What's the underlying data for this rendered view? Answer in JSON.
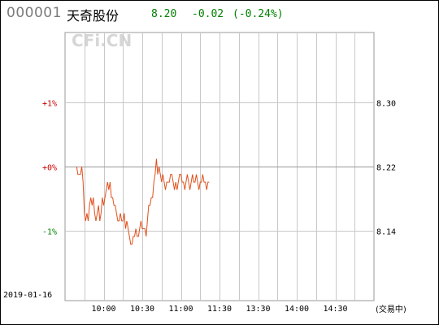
{
  "header": {
    "code": "000001",
    "name": "天奇股份",
    "price": "8.20",
    "change": "-0.02",
    "change_pct": "(-0.24%)"
  },
  "watermark": "CFi.CN",
  "date": "2019-01-16",
  "status": "(交易中)",
  "colors": {
    "up": "#cc0000",
    "flat": "#cc0000",
    "down": "#008000",
    "line": "#e0501c",
    "grid": "#c8c8c8",
    "zero": "#999999"
  },
  "chart_data": {
    "type": "line",
    "title": "",
    "xlabel": "",
    "ylabel": "",
    "prev_close": 8.22,
    "ylim_pct": [
      -2.1,
      2.1
    ],
    "grid": true,
    "x_ticks": [
      "10:00",
      "10:30",
      "11:00",
      "11:30",
      "13:30",
      "14:00",
      "14:30"
    ],
    "y_left_ticks": [
      {
        "label": "+1%",
        "pct": 1,
        "tone": "up"
      },
      {
        "label": "+0%",
        "pct": 0,
        "tone": "flat"
      },
      {
        "label": "-1%",
        "pct": -1,
        "tone": "down"
      }
    ],
    "y_right_ticks": [
      {
        "label": "8.30",
        "pct": 1
      },
      {
        "label": "8.22",
        "pct": 0
      },
      {
        "label": "8.14",
        "pct": -1
      }
    ],
    "session_minutes": [
      0,
      240
    ],
    "series": [
      {
        "x": [
          9,
          10,
          11,
          12,
          13,
          14,
          15,
          16,
          17,
          18,
          19,
          20,
          21,
          22,
          23,
          24,
          25,
          26,
          27,
          28,
          29,
          30,
          31,
          32,
          33,
          34,
          35,
          36,
          37,
          38,
          39,
          40,
          41,
          42,
          43,
          44,
          45,
          46,
          47,
          48,
          49,
          50,
          51,
          52,
          53,
          54,
          55,
          56,
          57,
          58,
          59,
          60,
          61,
          62,
          63,
          64,
          65,
          66,
          67,
          68,
          69,
          70,
          71,
          72,
          73,
          74,
          75,
          76,
          77,
          78,
          79,
          80,
          81,
          82,
          83,
          84,
          85,
          86,
          87,
          88,
          89,
          90,
          91,
          92,
          93,
          94,
          95,
          96,
          97,
          98,
          99,
          100,
          101,
          102,
          103,
          104,
          105,
          106,
          107,
          108,
          109,
          110,
          111,
          112
        ],
        "values": [
          8.22,
          8.21,
          8.21,
          8.21,
          8.22,
          8.2,
          8.16,
          8.15,
          8.16,
          8.15,
          8.17,
          8.18,
          8.17,
          8.18,
          8.16,
          8.15,
          8.16,
          8.17,
          8.15,
          8.16,
          8.18,
          8.17,
          8.18,
          8.19,
          8.2,
          8.19,
          8.2,
          8.18,
          8.18,
          8.17,
          8.17,
          8.16,
          8.15,
          8.15,
          8.16,
          8.15,
          8.15,
          8.16,
          8.14,
          8.15,
          8.14,
          8.13,
          8.12,
          8.12,
          8.13,
          8.13,
          8.14,
          8.13,
          8.13,
          8.14,
          8.15,
          8.14,
          8.14,
          8.14,
          8.13,
          8.15,
          8.17,
          8.17,
          8.18,
          8.18,
          8.2,
          8.21,
          8.23,
          8.21,
          8.22,
          8.21,
          8.2,
          8.21,
          8.2,
          8.19,
          8.2,
          8.2,
          8.2,
          8.21,
          8.21,
          8.2,
          8.19,
          8.2,
          8.19,
          8.2,
          8.21,
          8.21,
          8.2,
          8.2,
          8.19,
          8.2,
          8.21,
          8.2,
          8.19,
          8.2,
          8.21,
          8.2,
          8.2,
          8.21,
          8.2,
          8.19,
          8.2,
          8.2,
          8.21,
          8.2,
          8.2,
          8.19,
          8.2,
          8.2
        ]
      }
    ]
  }
}
